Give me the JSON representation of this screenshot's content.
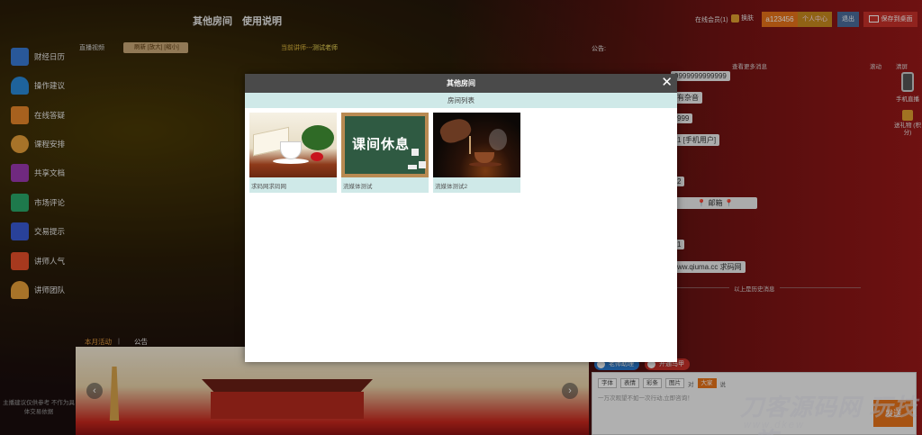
{
  "header": {
    "nav": [
      "其他房间",
      "使用说明"
    ],
    "online_label": "在线会员(1)",
    "skin_label": "换肤",
    "username": "a123456",
    "user_center": "个人中心",
    "logout": "退出",
    "save_desktop": "保存到桌面"
  },
  "sidebar": {
    "items": [
      {
        "label": "财经日历",
        "icon": "calendar-icon",
        "color": "#3a7bd5"
      },
      {
        "label": "操作建议",
        "icon": "bell-icon",
        "color": "#2a8ad8"
      },
      {
        "label": "在线答疑",
        "icon": "document-icon",
        "color": "#e8872a"
      },
      {
        "label": "课程安排",
        "icon": "person-chart-icon",
        "color": "#e8a03a"
      },
      {
        "label": "共享文档",
        "icon": "trend-icon",
        "color": "#9b3ab0"
      },
      {
        "label": "市场评论",
        "icon": "books-icon",
        "color": "#2aa86a"
      },
      {
        "label": "交易提示",
        "icon": "mail-icon",
        "color": "#3a5bd5"
      },
      {
        "label": "讲师人气",
        "icon": "thumbs-up-icon",
        "color": "#e8502a"
      },
      {
        "label": "讲师团队",
        "icon": "user-icon",
        "color": "#e8a03a"
      }
    ],
    "disclaimer": "主播建议仅供参考 不作为具体交易依据"
  },
  "video": {
    "title": "直播视频",
    "refresh": "刷新 [放大] [缩小]",
    "current_teacher_label": "当前讲师---",
    "current_teacher": "测试老师"
  },
  "chat": {
    "notice_label": "公告:",
    "more_messages": "查看更多消息",
    "scroll": "滚动",
    "clear": "清屏",
    "bubbles": [
      "9999999999999",
      "有杂音",
      "999",
      "1 [手机用户]",
      "2",
      "📍 邮箱 📍",
      "1",
      "ww.qiuma.cc 求码网"
    ],
    "history": "以上是历史消息",
    "mobile_label": "手机直播",
    "gift_label": "送礼物 (积分)",
    "teacher_help": "老师助理",
    "open_vest": "开通马甲",
    "tools": [
      "字体",
      "表情",
      "彩条",
      "图片"
    ],
    "to_label": "对",
    "target": "大家",
    "say_label": "说",
    "input_placeholder": "一万次观望不如一次行动,立即咨询！",
    "send": "发送"
  },
  "bottom": {
    "tabs": [
      "本月活动",
      "公告"
    ],
    "arrow_left": "‹",
    "arrow_right": "›"
  },
  "modal": {
    "title": "其他房间",
    "close": "✕",
    "subtitle": "房间列表",
    "rooms": [
      {
        "name": "求码网求码网"
      },
      {
        "name": "流媒体测试",
        "board_text": "课间休息"
      },
      {
        "name": "流媒体测试2"
      }
    ]
  },
  "watermark": {
    "main": "刀客源码网 玩技e族",
    "sub": "www.dkew"
  }
}
